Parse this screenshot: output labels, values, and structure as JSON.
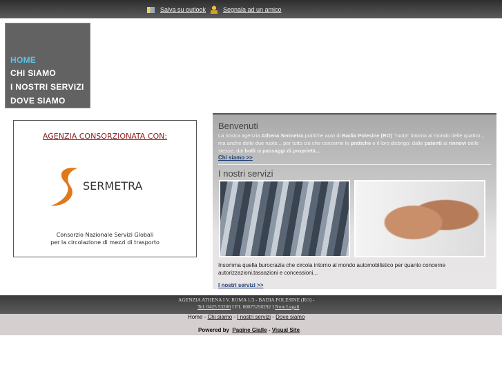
{
  "topbar": {
    "outlook_label": "Salva su outlook",
    "friend_label": "Segnala ad un amico"
  },
  "nav": {
    "items": [
      {
        "label": "HOME"
      },
      {
        "label": "CHI SIAMO"
      },
      {
        "label": "I NOSTRI SERVIZI"
      },
      {
        "label": "DOVE SIAMO"
      }
    ]
  },
  "logo": {
    "heading": "AGENZIA CONSORZIONATA CON:",
    "brand": "SERMETRA",
    "sub1": "Consorzio Nazionale Servizi Globali",
    "sub2": "per la circolazione di mezzi di trasporto"
  },
  "welcome": {
    "title": "Benvenuti",
    "t1": "La nostra agenzia ",
    "b1": "Athena Sermetra",
    "t2": " pratiche auto di ",
    "b2": "Badia Polesine (RO)",
    "t3": " \"ruota\" intorno al mondo delle quattro... ma anche delle due ruote... per tutto ciò che concerne le ",
    "b3": "pratiche",
    "t4": " e il loro disbrigo: dalle ",
    "b4": "patenti",
    "t5": " ai ",
    "b5": "rinnovi",
    "t6": " delle stesse, dai ",
    "b6": "bolli",
    "t7": " ai ",
    "b7": "passaggi di proprietà...",
    "link": "Chi siamo >>"
  },
  "services": {
    "title": "I nostri servizi",
    "text": "Insomma quella burocrazia che circola intorno al mondo automobilistico per quanto concerne autorizzazioni,tassazioni e concessioni...",
    "link": "I nostri servizi >>"
  },
  "footer": {
    "line1": "AGENZIA ATHENA I V. ROMA 1/3 - BADIA POLESINE (RO) -",
    "tel": "Tel. 0425 53200",
    "piva": " I P.I. 00875250292 I ",
    "legal": "Note Legali",
    "nav": [
      "Home",
      "Chi siamo",
      "I nostri servizi",
      "Dove siamo"
    ],
    "powered": "Powered by",
    "pg": "Pagine Gialle",
    "vs": "Visual Site"
  }
}
